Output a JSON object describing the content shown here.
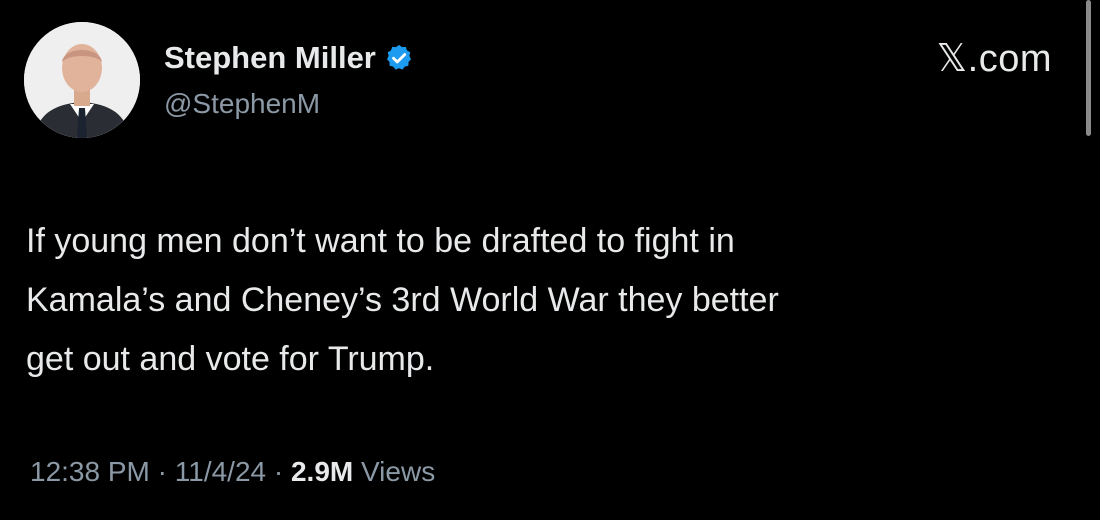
{
  "author": {
    "display_name": "Stephen Miller",
    "handle": "@StephenM",
    "verified_icon": "verified-badge-icon",
    "verified_color": "#1d9bf0"
  },
  "site_mark": "𝕏.com",
  "tweet": {
    "lines": [
      "If young men don’t want to be drafted to fight in",
      "Kamala’s and Cheney’s 3rd World War they better",
      "get out and vote for Trump."
    ]
  },
  "meta": {
    "time": "12:38 PM",
    "sep1": " · ",
    "date": "11/4/24",
    "sep2": " · ",
    "views_count": "2.9M",
    "views_label": " Views"
  },
  "colors": {
    "background": "#000000",
    "primary_text": "#e7e9ea",
    "secondary_text": "#8b98a5"
  }
}
